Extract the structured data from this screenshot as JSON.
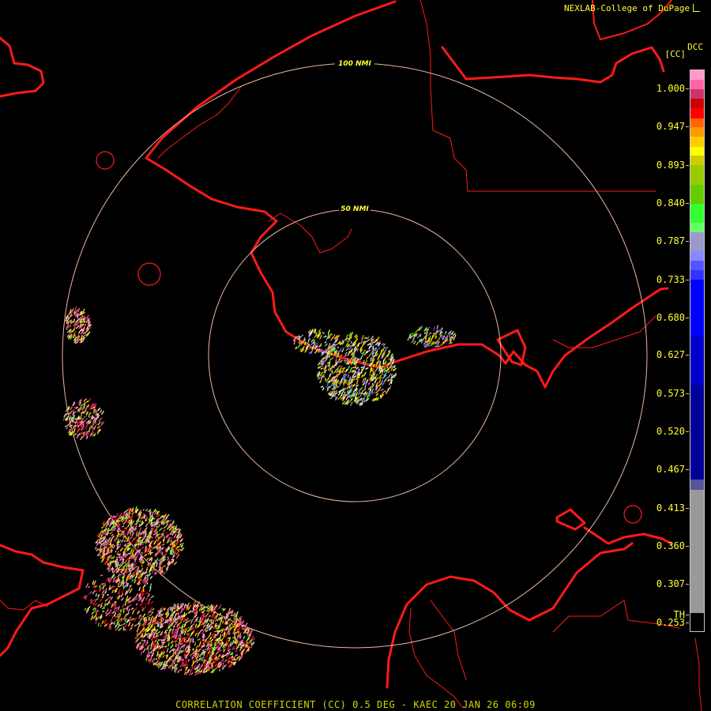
{
  "header": {
    "credit": "NEXLAB-College of DuPage",
    "product_code": "DCC",
    "product_unit": "[CC]"
  },
  "range_rings": [
    {
      "label": "50 NMI"
    },
    {
      "label": "100 NMI"
    }
  ],
  "legend": {
    "labels": [
      "1.000",
      "0.947",
      "0.893",
      "0.840",
      "0.787",
      "0.733",
      "0.680",
      "0.627",
      "0.573",
      "0.520",
      "0.467",
      "0.413",
      "0.360",
      "0.307",
      "0.253",
      "TH"
    ],
    "segments": [
      {
        "color": "#ff99cc",
        "from": 1.0,
        "to": 0.987
      },
      {
        "color": "#ff66aa",
        "from": 0.987,
        "to": 0.973
      },
      {
        "color": "#cc3366",
        "from": 0.973,
        "to": 0.96
      },
      {
        "color": "#cc0000",
        "from": 0.96,
        "to": 0.947
      },
      {
        "color": "#ff0000",
        "from": 0.947,
        "to": 0.933
      },
      {
        "color": "#ff6600",
        "from": 0.933,
        "to": 0.92
      },
      {
        "color": "#ff9900",
        "from": 0.92,
        "to": 0.907
      },
      {
        "color": "#ffcc00",
        "from": 0.907,
        "to": 0.893
      },
      {
        "color": "#ffff00",
        "from": 0.893,
        "to": 0.88
      },
      {
        "color": "#cccc00",
        "from": 0.88,
        "to": 0.867
      },
      {
        "color": "#99cc00",
        "from": 0.867,
        "to": 0.84
      },
      {
        "color": "#66cc00",
        "from": 0.84,
        "to": 0.813
      },
      {
        "color": "#33ff33",
        "from": 0.813,
        "to": 0.787
      },
      {
        "color": "#66ff66",
        "from": 0.787,
        "to": 0.773
      },
      {
        "color": "#9999cc",
        "from": 0.773,
        "to": 0.747
      },
      {
        "color": "#8888ff",
        "from": 0.747,
        "to": 0.733
      },
      {
        "color": "#5555ff",
        "from": 0.733,
        "to": 0.72
      },
      {
        "color": "#3333ff",
        "from": 0.72,
        "to": 0.707
      },
      {
        "color": "#0000ff",
        "from": 0.707,
        "to": 0.627
      },
      {
        "color": "#0000cc",
        "from": 0.627,
        "to": 0.56
      },
      {
        "color": "#000099",
        "from": 0.56,
        "to": 0.427
      },
      {
        "color": "#555599",
        "from": 0.427,
        "to": 0.413
      },
      {
        "color": "#999999",
        "from": 0.413,
        "to": 0.24
      },
      {
        "color": "#000000",
        "from": 0.24,
        "to": 0.213
      }
    ]
  },
  "colors": {
    "background": "#000000",
    "boundaries": "#ff1a1a",
    "range_rings": "#e8b8a0",
    "hud_text": "#ffff33"
  },
  "footer": "CORRELATION COEFFICIENT (CC) 0.5 DEG - KAEC 20 JAN 26 06:09"
}
